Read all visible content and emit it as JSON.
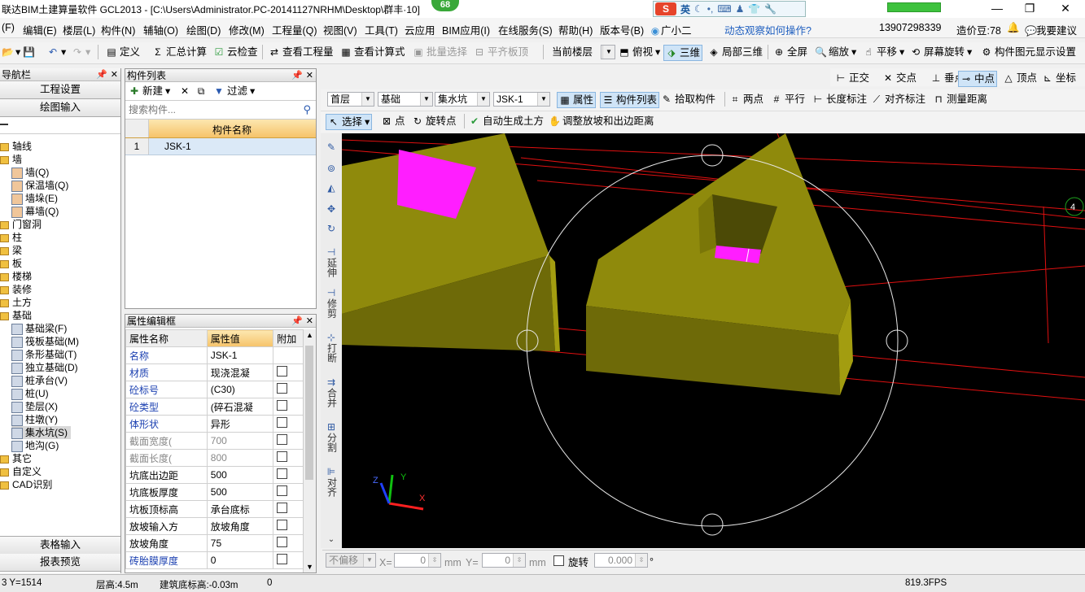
{
  "window": {
    "title": "联达BIM土建算量软件 GCL2013 - [C:\\Users\\Administrator.PC-20141127NRHM\\Desktop\\群丰·",
    "title_tail": "10]",
    "badge": "68",
    "ime_label": "英",
    "ime_logo": "S"
  },
  "menu": [
    "(F)",
    "编辑(E)",
    "楼层(L)",
    "构件(N)",
    "辅轴(O)",
    "绘图(D)",
    "修改(M)",
    "工程量(Q)",
    "视图(V)",
    "工具(T)",
    "云应用",
    "BIM应用(I)",
    "在线服务(S)",
    "帮助(H)",
    "版本号(B)",
    "广小二"
  ],
  "menu_right": {
    "hint": "动态观察如何操作?",
    "phone": "13907298339",
    "price": "造价豆:78",
    "suggest": "我要建议"
  },
  "toolbar1": [
    "定义",
    "汇总计算",
    "云检查",
    "查看工程量",
    "查看计算式",
    "批量选择",
    "平齐板顶",
    "当前楼层",
    "俯视",
    "三维",
    "局部三维",
    "全屏",
    "缩放",
    "平移",
    "屏幕旋转",
    "构件图元显示设置"
  ],
  "toolbar2": [
    "正交",
    "交点",
    "垂点",
    "中点",
    "顶点",
    "坐标"
  ],
  "selectors": {
    "floor": "首层",
    "category": "基础",
    "type": "集水坑",
    "component": "JSK-1"
  },
  "toolbar3": [
    "属性",
    "构件列表",
    "拾取构件",
    "两点",
    "平行",
    "长度标注",
    "对齐标注",
    "测量距离"
  ],
  "toolbar4": [
    "选择",
    "点",
    "旋转点",
    "自动生成土方",
    "调整放坡和出边距离"
  ],
  "nav": {
    "title": "导航栏",
    "btn1": "工程设置",
    "btn2": "绘图输入",
    "btn3": "表格输入",
    "btn4": "报表预览",
    "tree": [
      "轴线",
      "墙",
      "墙(Q)",
      "保温墙(Q)",
      "墙垛(E)",
      "幕墙(Q)",
      "门窗洞",
      "柱",
      "梁",
      "板",
      "楼梯",
      "装修",
      "土方",
      "基础",
      "基础梁(F)",
      "筏板基础(M)",
      "条形基础(T)",
      "独立基础(D)",
      "桩承台(V)",
      "桩(U)",
      "垫层(X)",
      "柱墩(Y)",
      "集水坑(S)",
      "地沟(G)",
      "其它",
      "自定义",
      "CAD识别"
    ]
  },
  "complist": {
    "title": "构件列表",
    "new_label": "新建",
    "filter_label": "过滤",
    "search_placeholder": "搜索构件...",
    "col_header": "构件名称",
    "rows": [
      {
        "num": "1",
        "name": "JSK-1"
      }
    ]
  },
  "props": {
    "title": "属性编辑框",
    "headers": [
      "属性名称",
      "属性值",
      "附加"
    ],
    "rows": [
      {
        "k": "名称",
        "v": "JSK-1",
        "style": "blue",
        "cb": false
      },
      {
        "k": "材质",
        "v": "现浇混凝",
        "style": "blue",
        "cb": true
      },
      {
        "k": "砼标号",
        "v": "(C30)",
        "style": "blue",
        "cb": true
      },
      {
        "k": "砼类型",
        "v": "(碎石混凝",
        "style": "blue",
        "cb": true
      },
      {
        "k": "体形状",
        "v": "异形",
        "style": "blue",
        "cb": true
      },
      {
        "k": "截面宽度(",
        "v": "700",
        "style": "gray",
        "cb": true
      },
      {
        "k": "截面长度(",
        "v": "800",
        "style": "gray",
        "cb": true
      },
      {
        "k": "坑底出边距",
        "v": "500",
        "style": "",
        "cb": true
      },
      {
        "k": "坑底板厚度",
        "v": "500",
        "style": "",
        "cb": true
      },
      {
        "k": "坑板顶标高",
        "v": "承台底标",
        "style": "",
        "cb": true
      },
      {
        "k": "放坡输入方",
        "v": "放坡角度",
        "style": "",
        "cb": true
      },
      {
        "k": "放坡角度",
        "v": "75",
        "style": "",
        "cb": true
      },
      {
        "k": "砖胎膜厚度",
        "v": "0",
        "style": "blue",
        "cb": true
      }
    ]
  },
  "lefttools": [
    "延伸",
    "修剪",
    "打断",
    "合并",
    "分割",
    "对齐"
  ],
  "bottombar": {
    "mode": "不偏移",
    "x_label": "X=",
    "x_value": "0",
    "y_label": "Y=",
    "y_value": "0",
    "unit": "mm",
    "rotate_label": "旋转",
    "rotate_value": "0.000",
    "deg": "°"
  },
  "status": {
    "coord": "3 Y=1514",
    "floor_height": "层高:4.5m",
    "base_elev": "建筑底标高:-0.03m",
    "value": "0",
    "fps": "819.3FPS"
  },
  "canvas": {
    "axis_label": "4",
    "colors": {
      "solid": "#8f8a0c",
      "solid_light": "#a39d10",
      "solid_dark": "#6e6a08",
      "magenta": "#ff1eff",
      "grid": "#e01010"
    }
  }
}
